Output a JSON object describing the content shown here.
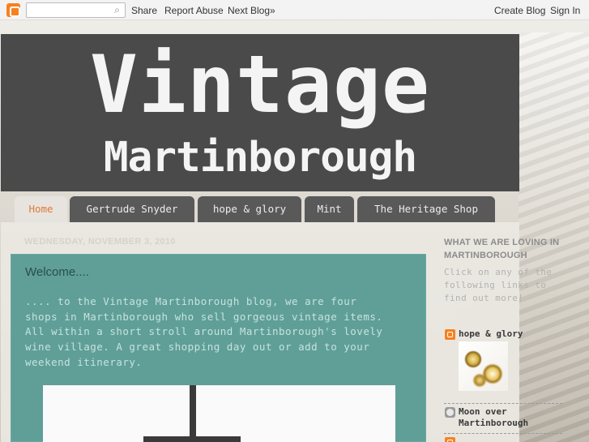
{
  "navbar": {
    "search_placeholder": "",
    "share_label": "Share",
    "report_label": "Report Abuse",
    "next_blog_label": "Next Blog»",
    "create_blog_label": "Create Blog",
    "sign_in_label": "Sign In"
  },
  "header": {
    "title_line1": "Vintage",
    "title_line2": "Martinborough"
  },
  "tabs": [
    {
      "label": "Home",
      "active": true
    },
    {
      "label": "Gertrude Snyder",
      "active": false
    },
    {
      "label": "hope & glory",
      "active": false
    },
    {
      "label": "Mint",
      "active": false
    },
    {
      "label": "The Heritage Shop",
      "active": false
    }
  ],
  "post": {
    "date": "WEDNESDAY, NOVEMBER 3, 2010",
    "title": "Welcome....",
    "body_lines": [
      ".... to the Vintage Martinborough blog, we are four",
      "shops in Martinborough who sell gorgeous vintage items.",
      "All within a short stroll around Martinborough's lovely",
      "wine village. A great shopping day out or add to your",
      "weekend itinerary."
    ]
  },
  "sidebar": {
    "heading_line1": "WHAT WE ARE LOVING IN",
    "heading_line2": "MARTINBOROUGH",
    "intro_lines": [
      "Click on any of the",
      "following links to",
      "find out more!"
    ],
    "items": [
      {
        "label": "hope & glory",
        "icon": "blogger-icon"
      },
      {
        "label_line1": "Moon over",
        "label_line2": "Martinborough",
        "icon": "moon-icon"
      }
    ]
  },
  "colors": {
    "header_bg": "#4a4a4a",
    "tab_bg": "#595959",
    "tab_active_text": "#e07a3a",
    "post_bg": "#5f9f98",
    "blogger_orange": "#f58220"
  }
}
